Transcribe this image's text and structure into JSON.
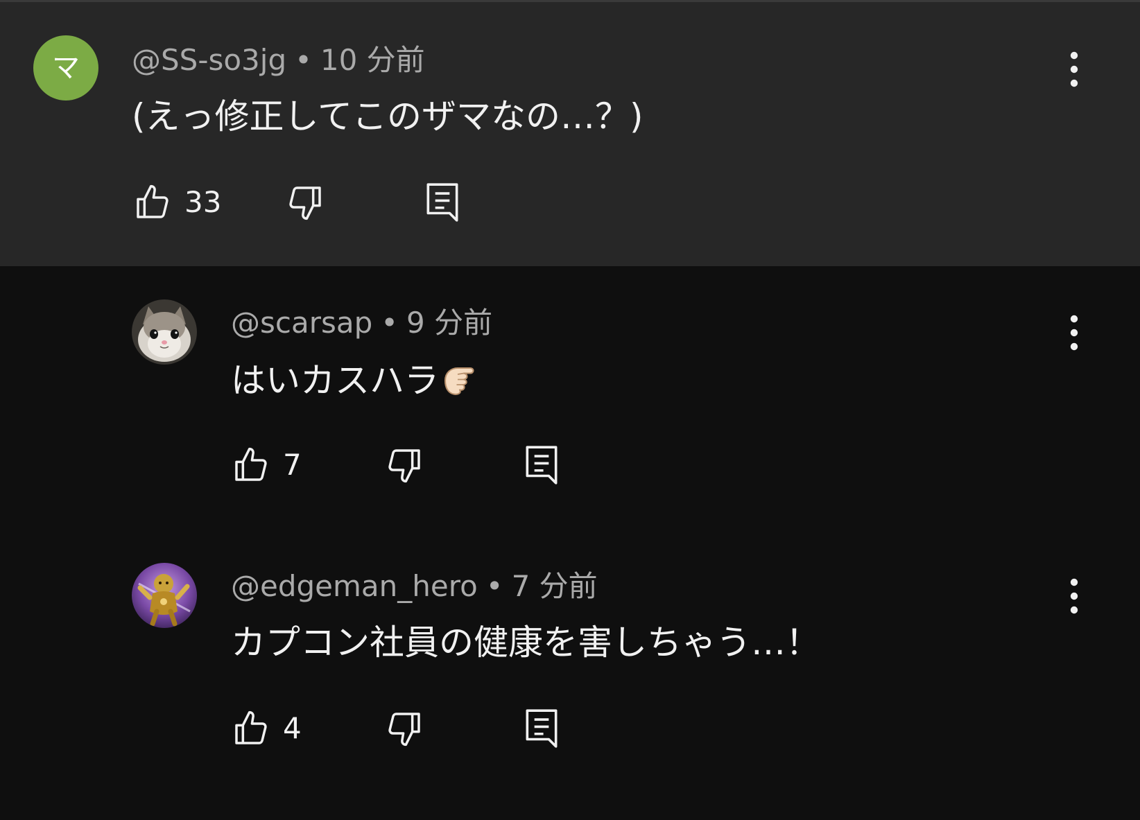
{
  "comments": [
    {
      "author": "@SS-so3jg",
      "separator": "•",
      "time": "10 分前",
      "avatar_letter": "マ",
      "avatar_color": "#7cab45",
      "text": "(えっ修正してこのザマなの…？)",
      "likes": "33"
    },
    {
      "author": "@scarsap",
      "separator": "•",
      "time": "9 分前",
      "avatar_icon": "cat-avatar-icon",
      "text": "はいカスハラ",
      "emoji": "pointing-finger-emoji",
      "likes": "7"
    },
    {
      "author": "@edgeman_hero",
      "separator": "•",
      "time": "7 分前",
      "avatar_icon": "golden-figure-avatar-icon",
      "text": "カプコン社員の健康を害しちゃう…！",
      "likes": "4"
    }
  ],
  "theme": {
    "background": "#0f0f0f",
    "highlight_background": "#272727",
    "meta_color": "#aaaaaa",
    "text_color": "#f1f1f1"
  }
}
